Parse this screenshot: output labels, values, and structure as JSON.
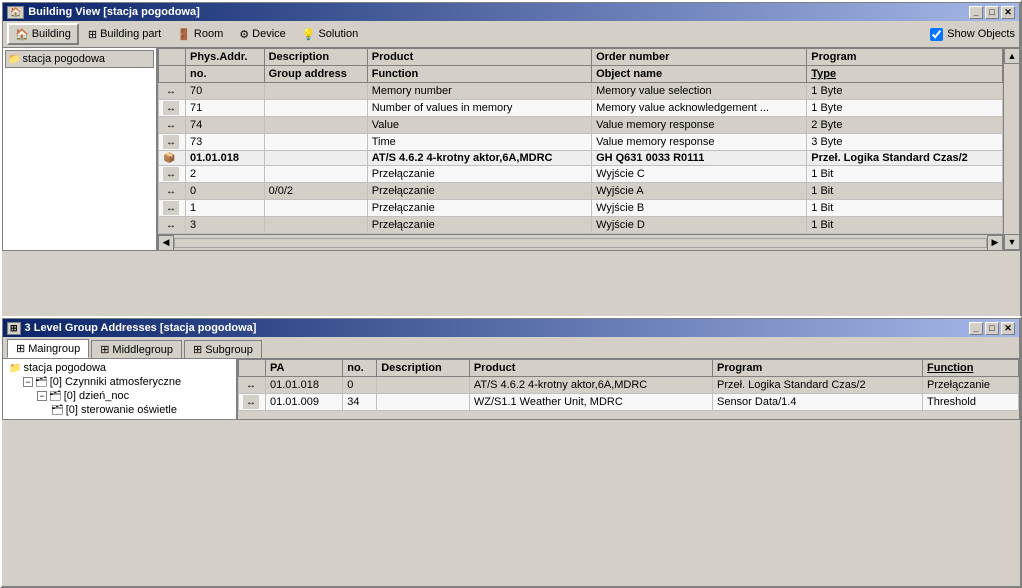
{
  "win1": {
    "title": "Building View [stacja pogodowa]",
    "toolbar": {
      "building_label": "Building",
      "building_part_label": "Building part",
      "room_label": "Room",
      "device_label": "Device",
      "solution_label": "Solution",
      "show_objects_label": "Show Objects"
    },
    "tree": {
      "root": "stacja pogodowa"
    },
    "table": {
      "headers": [
        "",
        "Phys.Addr.",
        "Description",
        "Product",
        "Order number",
        "Program"
      ],
      "subheaders": [
        "",
        "no.",
        "Group address",
        "Function",
        "Object name",
        "Type"
      ],
      "rows": [
        {
          "type": "data",
          "no": "70",
          "group_addr": "",
          "function": "Memory number",
          "object_name": "Memory value selection",
          "type_val": "1 Byte",
          "icon": "arrow"
        },
        {
          "type": "data",
          "no": "71",
          "group_addr": "",
          "function": "Number of values in memory",
          "object_name": "Memory value acknowledgement ...",
          "type_val": "1 Byte",
          "icon": "arrow"
        },
        {
          "type": "data",
          "no": "74",
          "group_addr": "",
          "function": "Value",
          "object_name": "Value memory response",
          "type_val": "2 Byte",
          "icon": "arrow"
        },
        {
          "type": "data",
          "no": "73",
          "group_addr": "",
          "function": "Time",
          "object_name": "Value memory response",
          "type_val": "3 Byte",
          "icon": "arrow"
        },
        {
          "type": "group",
          "phys_addr": "01.01.018",
          "product": "AT/S 4.6.2 4-krotny aktor,6A,MDRC",
          "order_num": "GH Q631 0033 R0111",
          "program": "Przeł. Logika Standard Czas/2"
        },
        {
          "type": "data",
          "no": "2",
          "group_addr": "",
          "function": "Przełączanie",
          "object_name": "Wyjście C",
          "type_val": "1 Bit",
          "icon": "arrow"
        },
        {
          "type": "data",
          "no": "0",
          "group_addr": "0/0/2",
          "function": "Przełączanie",
          "object_name": "Wyjście A",
          "type_val": "1 Bit",
          "icon": "arrow"
        },
        {
          "type": "data",
          "no": "1",
          "group_addr": "",
          "function": "Przełączanie",
          "object_name": "Wyjście B",
          "type_val": "1 Bit",
          "icon": "arrow"
        },
        {
          "type": "data",
          "no": "3",
          "group_addr": "",
          "function": "Przełączanie",
          "object_name": "Wyjście D",
          "type_val": "1 Bit",
          "icon": "arrow"
        }
      ]
    }
  },
  "win2": {
    "title": "3 Level Group Addresses [stacja pogodowa]",
    "tabs": [
      {
        "label": "Maingroup",
        "active": true
      },
      {
        "label": "Middlegroup",
        "active": false
      },
      {
        "label": "Subgroup",
        "active": false
      }
    ],
    "tree": {
      "root": "stacja pogodowa",
      "children": [
        {
          "label": "[0] Czynniki atmosferyczne",
          "children": [
            {
              "label": "[0]  dzień_noc",
              "children": [
                {
                  "label": "[0] sterowanie oświetle"
                }
              ]
            }
          ]
        }
      ]
    },
    "table": {
      "headers": [
        "",
        "PA",
        "no.",
        "Description",
        "Product",
        "Program",
        "Function"
      ],
      "rows": [
        {
          "pa": "01.01.018",
          "no": "0",
          "desc": "",
          "product": "AT/S 4.6.2 4-krotny aktor,6A,MDRC",
          "program": "Przeł. Logika Standard Czas/2",
          "function": "Przełączanie"
        },
        {
          "pa": "01.01.009",
          "no": "34",
          "desc": "",
          "product": "WZ/S1.1 Weather Unit, MDRC",
          "program": "Sensor Data/1.4",
          "function": "Threshold"
        }
      ]
    }
  }
}
